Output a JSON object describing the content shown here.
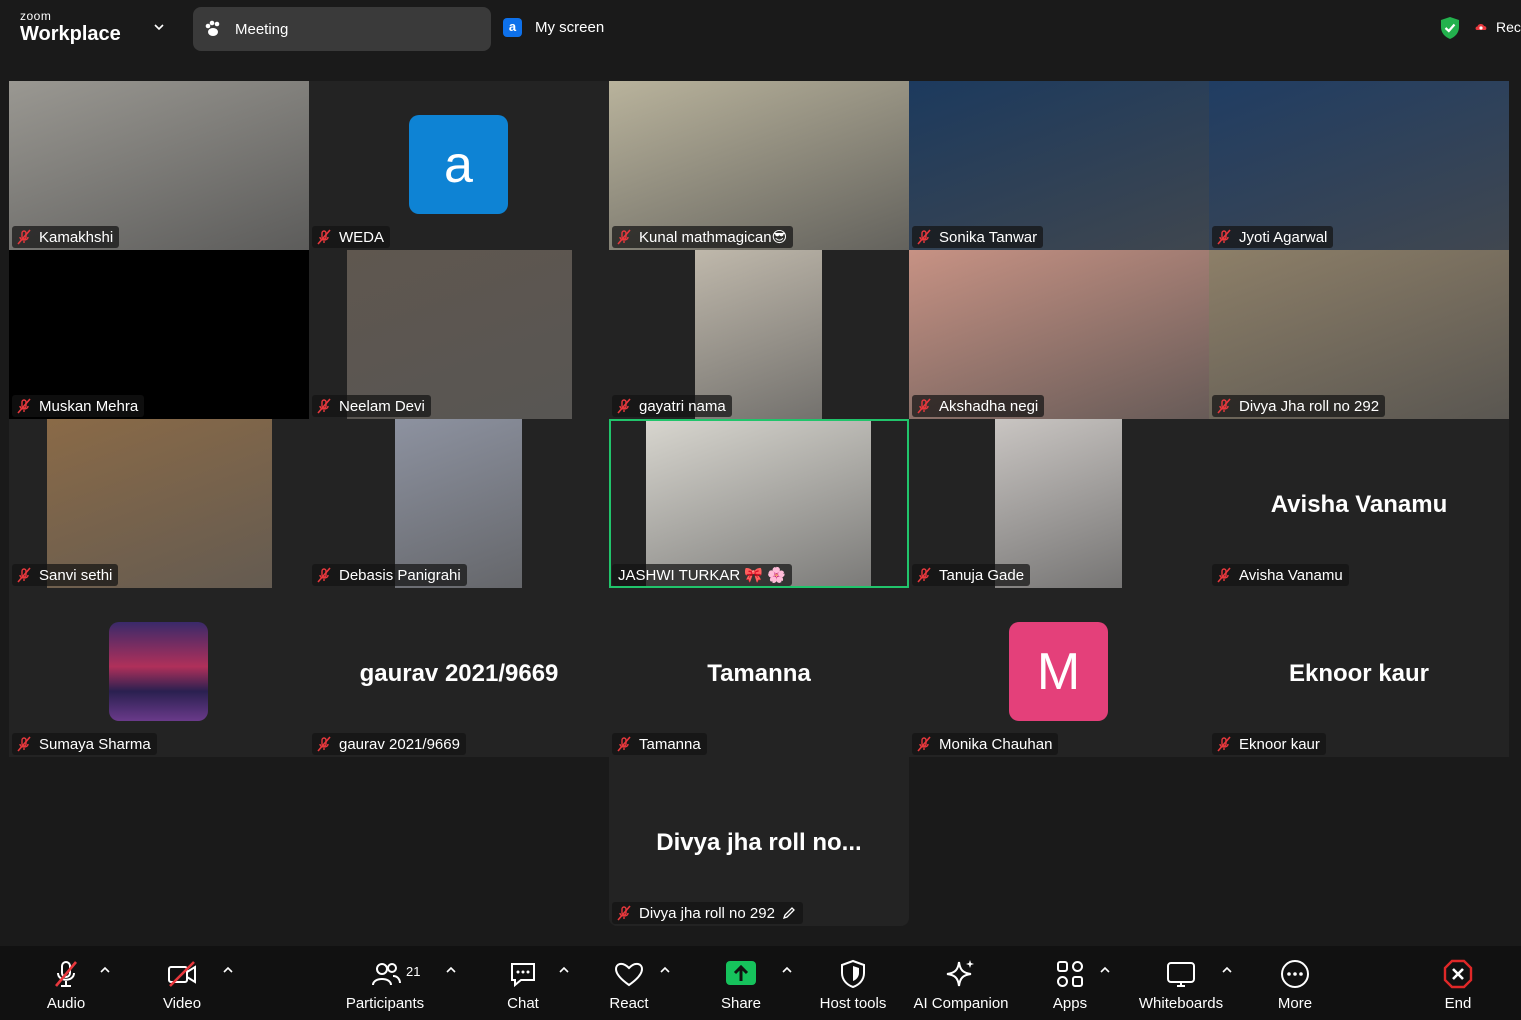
{
  "brand": {
    "small": "zoom",
    "big": "Workplace"
  },
  "tabs": {
    "meeting": "Meeting",
    "screen_icon": "a",
    "screen": "My screen"
  },
  "status": {
    "recording": "Rec"
  },
  "participants": [
    {
      "name": "Kamakhshi",
      "tile": "video",
      "scene": "#9a9892"
    },
    {
      "name": "WEDA",
      "tile": "avatar",
      "avatar_letter": "a",
      "avatar_color": "#0e83d4"
    },
    {
      "name": "Kunal mathmagican😎",
      "tile": "video",
      "scene": "#b9b39c"
    },
    {
      "name": "Sonika Tanwar",
      "tile": "video",
      "scene": "#1c3a5e"
    },
    {
      "name": "Jyoti Agarwal",
      "tile": "video",
      "scene": "#203d63"
    },
    {
      "name": "Muskan Mehra",
      "tile": "black"
    },
    {
      "name": "Neelam Devi",
      "tile": "video-narrow",
      "scene": "#5f574f"
    },
    {
      "name": "gayatri nama",
      "tile": "video-narrow",
      "scene": "#bfb8ab"
    },
    {
      "name": "Akshadha negi",
      "tile": "video",
      "scene": "#c79284"
    },
    {
      "name": "Divya Jha roll no 292",
      "tile": "video",
      "scene": "#8d7f68"
    },
    {
      "name": "Sanvi sethi",
      "tile": "video-narrow",
      "scene": "#8a6a47"
    },
    {
      "name": "Debasis Panigrahi",
      "tile": "video-narrow",
      "scene": "#8d92a0"
    },
    {
      "name": "JASHWI TURKAR 🎀 🌸",
      "tile": "video-narrow",
      "scene": "#d8d6cf",
      "active": true
    },
    {
      "name": "Tanuja Gade",
      "tile": "video-narrow",
      "scene": "#c9c5c2"
    },
    {
      "name": "Avisha Vanamu",
      "tile": "name",
      "display": "Avisha Vanamu"
    },
    {
      "name": "Sumaya Sharma",
      "tile": "avatar-photo"
    },
    {
      "name": "gaurav 2021/9669",
      "tile": "name",
      "display": "gaurav 2021/9669"
    },
    {
      "name": "Tamanna",
      "tile": "name",
      "display": "Tamanna"
    },
    {
      "name": "Monika Chauhan",
      "tile": "avatar",
      "avatar_letter": "M",
      "avatar_color": "#e4407a"
    },
    {
      "name": "Eknoor kaur",
      "tile": "name",
      "display": "Eknoor kaur"
    },
    {
      "name": "Divya jha roll no 292",
      "tile": "name",
      "display": "Divya jha roll no...",
      "pencil": true
    }
  ],
  "toolbar": {
    "audio": "Audio",
    "video": "Video",
    "participants": "Participants",
    "participants_count": "21",
    "chat": "Chat",
    "react": "React",
    "share": "Share",
    "host_tools": "Host tools",
    "ai_companion": "AI Companion",
    "apps": "Apps",
    "whiteboards": "Whiteboards",
    "more": "More",
    "end": "End"
  },
  "colors": {
    "share_green": "#16c25c",
    "active_border": "#21c46b",
    "end_red": "#e02828",
    "mute_red": "#e8383d"
  }
}
